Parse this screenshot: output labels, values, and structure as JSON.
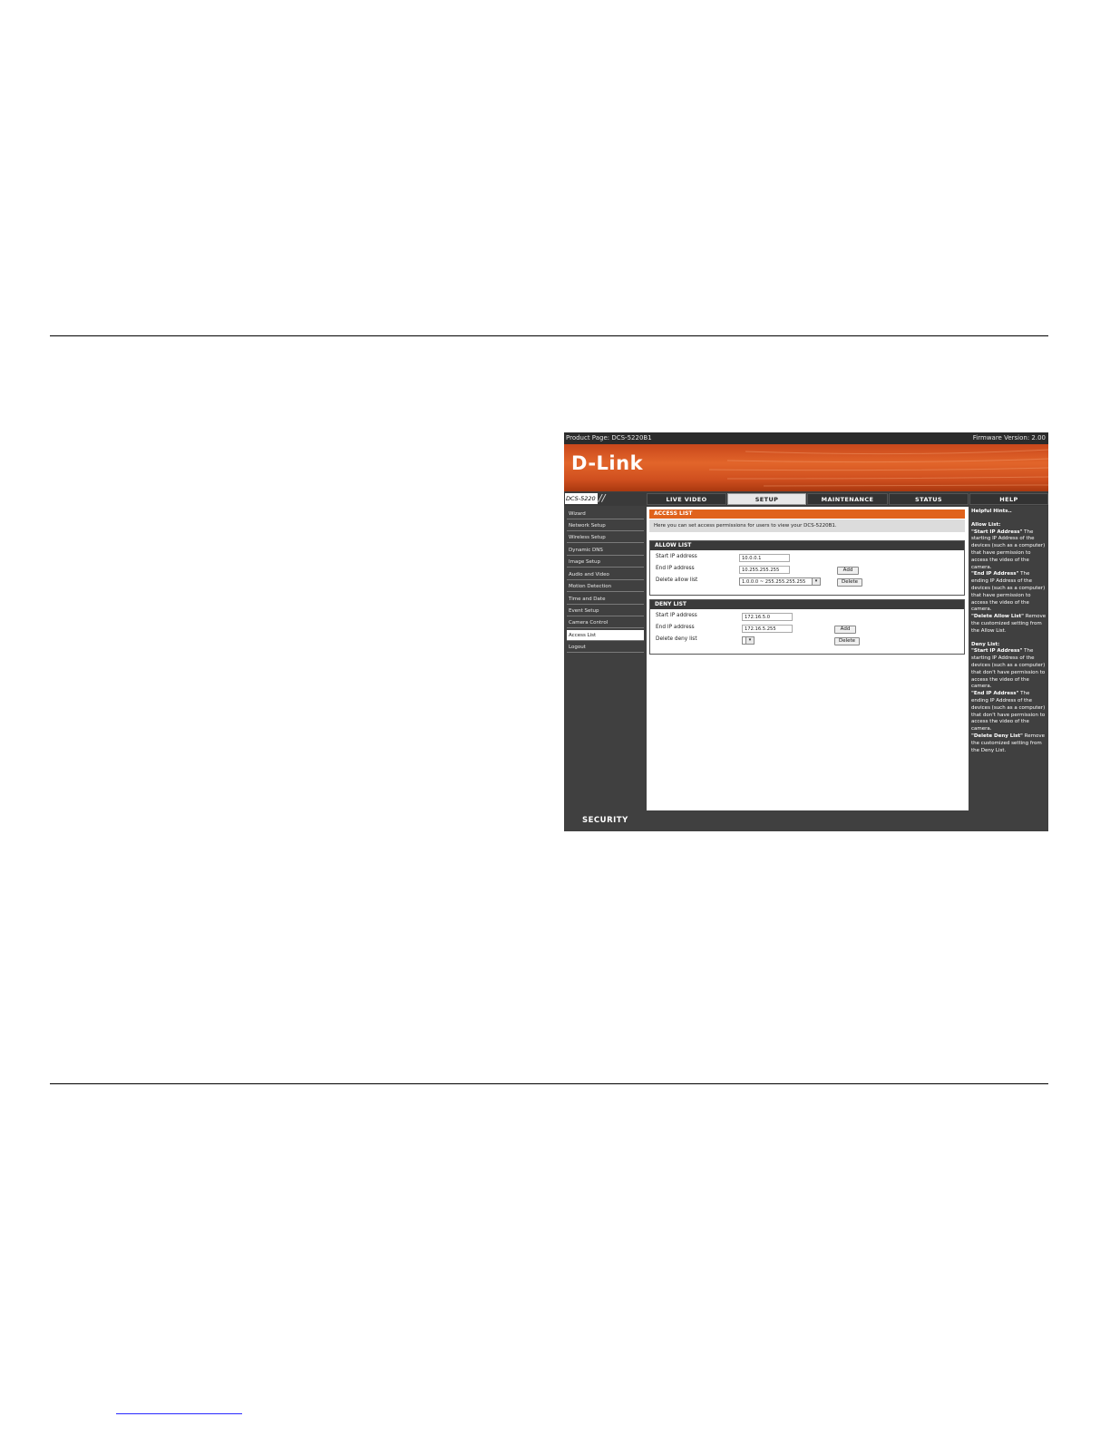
{
  "header": {
    "product_page": "Product Page: DCS-5220B1",
    "firmware": "Firmware Version: 2.00",
    "logo": "D-Link"
  },
  "nav": {
    "model": "DCS-5220",
    "tabs": [
      "LIVE VIDEO",
      "SETUP",
      "MAINTENANCE",
      "STATUS",
      "HELP"
    ],
    "active_tab": "SETUP"
  },
  "sidebar": {
    "items": [
      "Wizard",
      "Network Setup",
      "Wireless Setup",
      "Dynamic DNS",
      "Image Setup",
      "Audio and Video",
      "Motion Detection",
      "Time and Date",
      "Event Setup",
      "Camera Control",
      "Access List",
      "Logout"
    ],
    "active_item": "Access List"
  },
  "main": {
    "title": "ACCESS LIST",
    "intro": "Here you can set access permissions for users to view your DCS-5220B1.",
    "allow": {
      "title": "ALLOW LIST",
      "start_label": "Start IP address",
      "start_value": "10.0.0.1",
      "end_label": "End IP address",
      "end_value": "10.255.255.255",
      "delete_label": "Delete allow list",
      "delete_selected": "1.0.0.0 ~ 255.255.255.255",
      "add_button": "Add",
      "delete_button": "Delete"
    },
    "deny": {
      "title": "DENY LIST",
      "start_label": "Start IP address",
      "start_value": "172.16.5.0",
      "end_label": "End IP address",
      "end_value": "172.16.5.255",
      "delete_label": "Delete deny list",
      "delete_selected": "",
      "add_button": "Add",
      "delete_button": "Delete"
    }
  },
  "hints": {
    "heading": "Helpful Hints..",
    "allow_heading": "Allow List:",
    "allow_start_term": "\"Start IP Address\"",
    "allow_start_desc": "The starting IP Address of the devices (such as a computer) that have permission to access the video of the camera.",
    "allow_end_term": "\"End IP Address\"",
    "allow_end_desc": "The ending IP Address of the devices (such as a computer) that have permission to access the video of the camera.",
    "allow_delete_term": "\"Delete Allow List\"",
    "allow_delete_desc": "Remove the customized setting from the Allow List.",
    "deny_heading": "Deny List:",
    "deny_start_term": "\"Start IP Address\"",
    "deny_start_desc": "The starting IP Address of the devices (such as a computer) that don't have permission to access the video of the camera.",
    "deny_end_term": "\"End IP Address\"",
    "deny_end_desc": "The ending IP Address of the devices (such as a computer) that don't have permission to access the video of the camera.",
    "deny_delete_term": "\"Delete Deny List\"",
    "deny_delete_desc": "Remove the customized setting from the Deny List."
  },
  "footer": {
    "label": "SECURITY"
  },
  "colors": {
    "accent": "#e0621c",
    "dark": "#404040"
  }
}
